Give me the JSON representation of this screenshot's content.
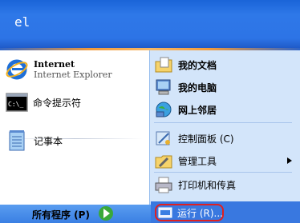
{
  "user": {
    "name": "el"
  },
  "pinned": [
    {
      "title": "Internet",
      "subtitle": "Internet Explorer",
      "icon": "internet-explorer-icon"
    },
    {
      "title": "命令提示符",
      "icon": "command-prompt-icon"
    }
  ],
  "recent": [
    {
      "title": "记事本",
      "icon": "notepad-icon"
    }
  ],
  "all_programs": "所有程序 (P)",
  "places": [
    {
      "label": "我的文档",
      "icon": "my-documents-icon"
    },
    {
      "label": "我的电脑",
      "icon": "my-computer-icon"
    },
    {
      "label": "网上邻居",
      "icon": "network-places-icon"
    },
    {
      "label": "控制面板 (C)",
      "icon": "control-panel-icon"
    },
    {
      "label": "管理工具",
      "icon": "admin-tools-icon"
    },
    {
      "label": "打印机和传真",
      "icon": "printer-icon"
    },
    {
      "label": "运行 (R)...",
      "icon": "run-icon"
    }
  ],
  "colors": {
    "header": "#2e78e8",
    "right_panel": "#d3e5fa",
    "highlight": "#e02020"
  }
}
